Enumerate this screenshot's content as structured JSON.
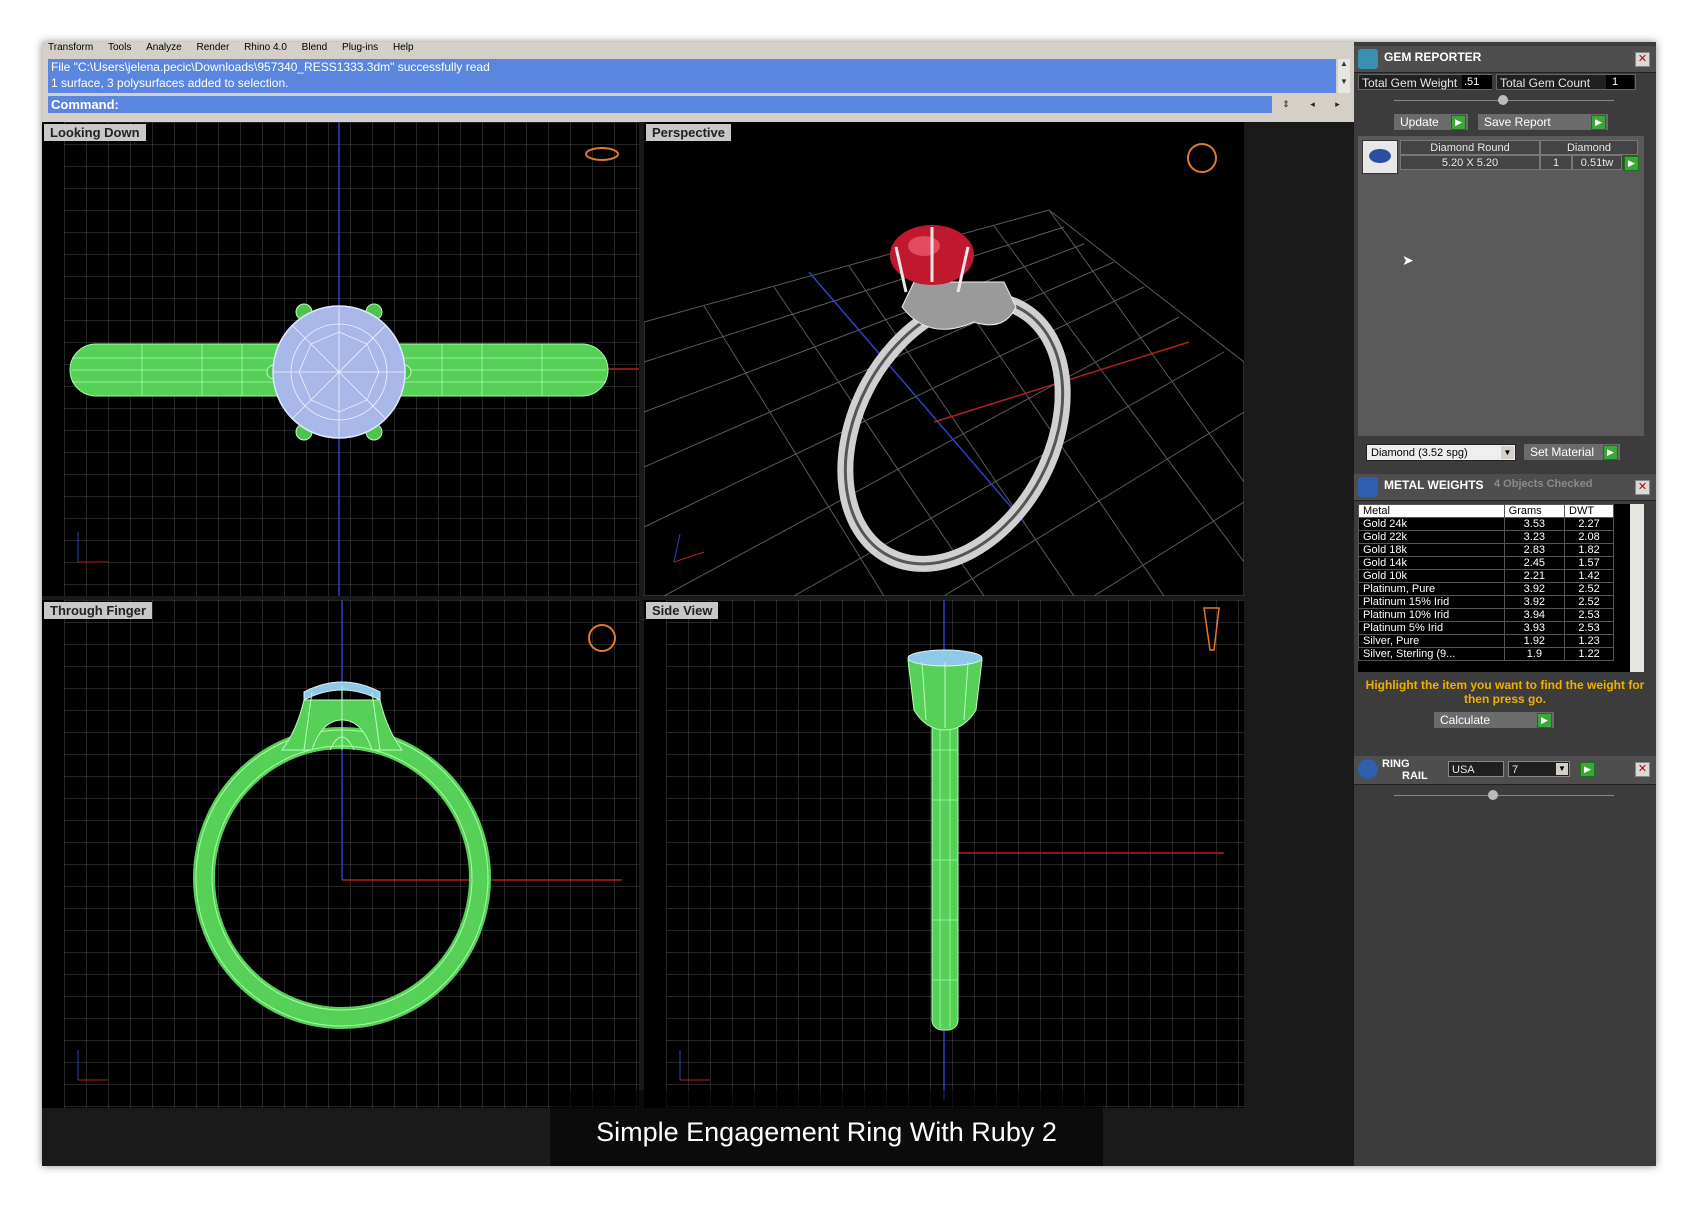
{
  "menu": [
    "Transform",
    "Tools",
    "Analyze",
    "Render",
    "Rhino 4.0",
    "Blend",
    "Plug-ins",
    "Help"
  ],
  "command": {
    "history": [
      "File \"C:\\Users\\jelena.pecic\\Downloads\\957340_RESS1333.3dm\" successfully read",
      "1 surface, 3 polysurfaces added to selection."
    ],
    "prompt": "Command:"
  },
  "viewports": {
    "top": "Looking Down",
    "perspective": "Perspective",
    "front": "Through Finger",
    "right": "Side View"
  },
  "gem_reporter": {
    "title": "GEM REPORTER",
    "total_weight_label": "Total Gem Weight",
    "total_weight": ".51",
    "total_count_label": "Total Gem Count",
    "total_count": "1",
    "update": "Update",
    "save_report": "Save Report",
    "gem": {
      "name": "Diamond Round",
      "type": "Diamond",
      "size": "5.20 X 5.20",
      "qty": "1",
      "weight": "0.51tw"
    },
    "material_select": "Diamond    (3.52 spg)",
    "set_material": "Set Material"
  },
  "metal_weights": {
    "title": "METAL WEIGHTS",
    "status": "4 Objects Checked",
    "headers": [
      "Metal",
      "Grams",
      "DWT"
    ],
    "rows": [
      [
        "Gold 24k",
        "3.53",
        "2.27"
      ],
      [
        "Gold 22k",
        "3.23",
        "2.08"
      ],
      [
        "Gold 18k",
        "2.83",
        "1.82"
      ],
      [
        "Gold 14k",
        "2.45",
        "1.57"
      ],
      [
        "Gold 10k",
        "2.21",
        "1.42"
      ],
      [
        "Platinum, Pure",
        "3.92",
        "2.52"
      ],
      [
        "Platinum 15% Irid",
        "3.92",
        "2.52"
      ],
      [
        "Platinum 10% Irid",
        "3.94",
        "2.53"
      ],
      [
        "Platinum 5% Irid",
        "3.93",
        "2.53"
      ],
      [
        "Silver, Pure",
        "1.92",
        "1.23"
      ],
      [
        "Silver, Sterling (9...",
        "1.9",
        "1.22"
      ]
    ],
    "hint": "Highlight the item you want to find the weight for then press go.",
    "calculate": "Calculate"
  },
  "ring_rail": {
    "title_1": "RING",
    "title_2": "RAIL",
    "country": "USA",
    "size": "7"
  },
  "caption": "Simple Engagement Ring With Ruby 2",
  "colors": {
    "wire_green": "#5cd65c",
    "grid": "#555555",
    "ruby": "#c0182e",
    "panel": "#3c3c3c",
    "hint": "#f0b000"
  }
}
